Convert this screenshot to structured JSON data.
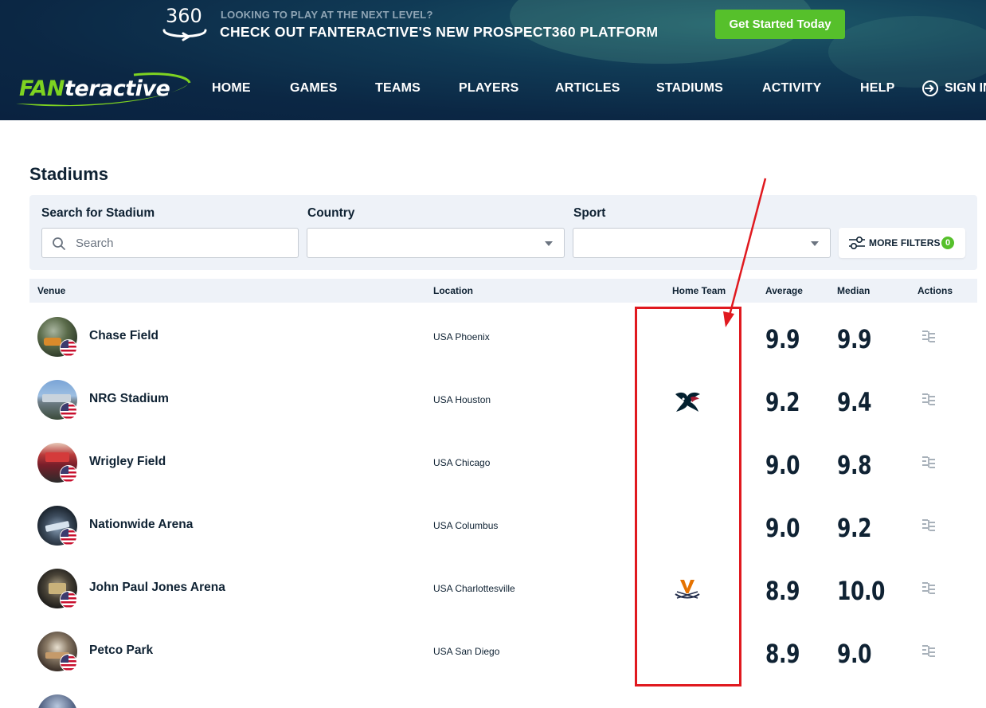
{
  "promo": {
    "logo_number": "360",
    "small_text": "LOOKING TO PLAY AT THE NEXT LEVEL?",
    "big_text": "CHECK OUT FANTERACTIVE'S NEW PROSPECT360 PLATFORM",
    "cta_label": "Get Started Today"
  },
  "brand": {
    "fan": "FAN",
    "rest": "teractive"
  },
  "nav": {
    "home": "HOME",
    "games": "GAMES",
    "teams": "TEAMS",
    "players": "PLAYERS",
    "articles": "ARTICLES",
    "stadiums": "STADIUMS",
    "activity": "ACTIVITY",
    "help": "HELP",
    "sign_in": "SIGN IN"
  },
  "page": {
    "title": "Stadiums"
  },
  "filters": {
    "search_label": "Search for Stadium",
    "search_placeholder": "Search",
    "country_label": "Country",
    "country_value": "",
    "sport_label": "Sport",
    "sport_value": "",
    "more_filters_label": "MORE FILTERS",
    "more_filters_count": "0"
  },
  "table": {
    "headers": {
      "venue": "Venue",
      "location": "Location",
      "home_team": "Home Team",
      "average": "Average",
      "median": "Median",
      "actions": "Actions"
    },
    "rows": [
      {
        "venue": "Chase Field",
        "location": "USA Phoenix",
        "home_team_logo": "",
        "average": "9.9",
        "median": "9.9"
      },
      {
        "venue": "NRG Stadium",
        "location": "USA Houston",
        "home_team_logo": "texans-logo-icon",
        "average": "9.2",
        "median": "9.4"
      },
      {
        "venue": "Wrigley Field",
        "location": "USA Chicago",
        "home_team_logo": "",
        "average": "9.0",
        "median": "9.8"
      },
      {
        "venue": "Nationwide Arena",
        "location": "USA Columbus",
        "home_team_logo": "",
        "average": "9.0",
        "median": "9.2"
      },
      {
        "venue": "John Paul Jones Arena",
        "location": "USA Charlottesville",
        "home_team_logo": "virginia-logo-icon",
        "average": "8.9",
        "median": "10.0"
      },
      {
        "venue": "Petco Park",
        "location": "USA San Diego",
        "home_team_logo": "",
        "average": "8.9",
        "median": "9.0"
      }
    ]
  },
  "colors": {
    "header_bg": "#0b2744",
    "accent_green": "#56c02b",
    "text_dark": "#0f2233",
    "panel_bg": "#eef2f8",
    "annotation_red": "#e0191f"
  }
}
